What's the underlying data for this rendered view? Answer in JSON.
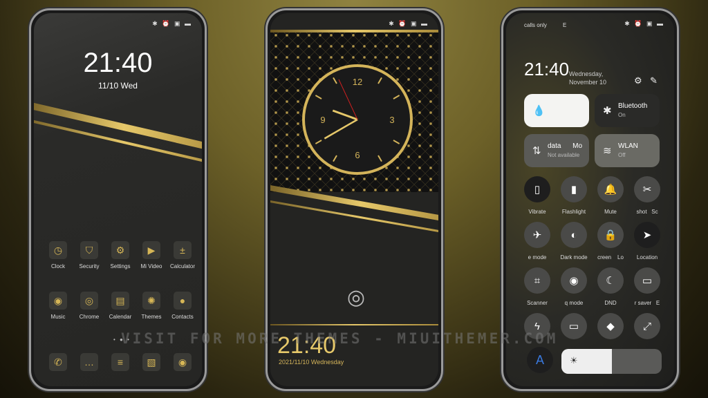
{
  "status_icons": "✱ ⏰ ▣ ▬",
  "watermark": "VISIT FOR MORE THEMES - MIUITHEMER.COM",
  "home": {
    "time": "21:40",
    "date": "11/10 Wed",
    "apps": [
      {
        "label": "Clock",
        "icon": "◷"
      },
      {
        "label": "Security",
        "icon": "⛉"
      },
      {
        "label": "Settings",
        "icon": "⚙"
      },
      {
        "label": "Mi Video",
        "icon": "▶"
      },
      {
        "label": "Calculator",
        "icon": "±"
      },
      {
        "label": "Music",
        "icon": "◉"
      },
      {
        "label": "Chrome",
        "icon": "◎"
      },
      {
        "label": "Calendar",
        "icon": "▤"
      },
      {
        "label": "Themes",
        "icon": "✺"
      },
      {
        "label": "Contacts",
        "icon": "●"
      }
    ],
    "dock": [
      {
        "name": "phone",
        "icon": "✆"
      },
      {
        "name": "messages",
        "icon": "…"
      },
      {
        "name": "notes",
        "icon": "≡"
      },
      {
        "name": "gallery",
        "icon": "▧"
      },
      {
        "name": "camera",
        "icon": "◉"
      }
    ]
  },
  "lock": {
    "clock": {
      "numerals": [
        "12",
        "3",
        "6",
        "9"
      ],
      "hour": 21,
      "minute": 40
    },
    "time": "21:40",
    "date": "2021/11/10 Wednesday",
    "fingerprint_icon": "fingerprint-icon"
  },
  "control": {
    "carrier": "calls only",
    "carrier2": "E",
    "time": "21:40",
    "date1": "Wednesday,",
    "date2": "November 10",
    "tiles": [
      {
        "title": "",
        "sub": "",
        "icon": "💧"
      },
      {
        "title": "Bluetooth",
        "sub": "On",
        "icon": "✱"
      },
      {
        "title": "data      Mo",
        "sub": "Not available",
        "icon": "⇅"
      },
      {
        "title": "WLAN",
        "sub": "Off",
        "icon": "≋"
      }
    ],
    "toggles": [
      {
        "label": "Vibrate",
        "icon": "▯"
      },
      {
        "label": "Flashlight",
        "icon": "▮"
      },
      {
        "label": "Mute",
        "icon": "🔔"
      },
      {
        "label": "shot   Sc",
        "icon": "✂"
      },
      {
        "label": "e mode",
        "icon": "✈"
      },
      {
        "label": "Dark mode",
        "icon": "◐"
      },
      {
        "label": "creen    Lo",
        "icon": "🔒"
      },
      {
        "label": "Location",
        "icon": "➤"
      },
      {
        "label": "Scanner",
        "icon": "⌗"
      },
      {
        "label": "q mode",
        "icon": "◉"
      },
      {
        "label": "DND",
        "icon": "☾"
      },
      {
        "label": "r saver   E",
        "icon": "▭"
      },
      {
        "label": "",
        "icon": "ϟ"
      },
      {
        "label": "",
        "icon": "▭"
      },
      {
        "label": "",
        "icon": "◆"
      },
      {
        "label": "",
        "icon": "⤢"
      }
    ],
    "auto_brightness": "A",
    "brightness_icon": "☀",
    "brightness_level": 0.5
  }
}
